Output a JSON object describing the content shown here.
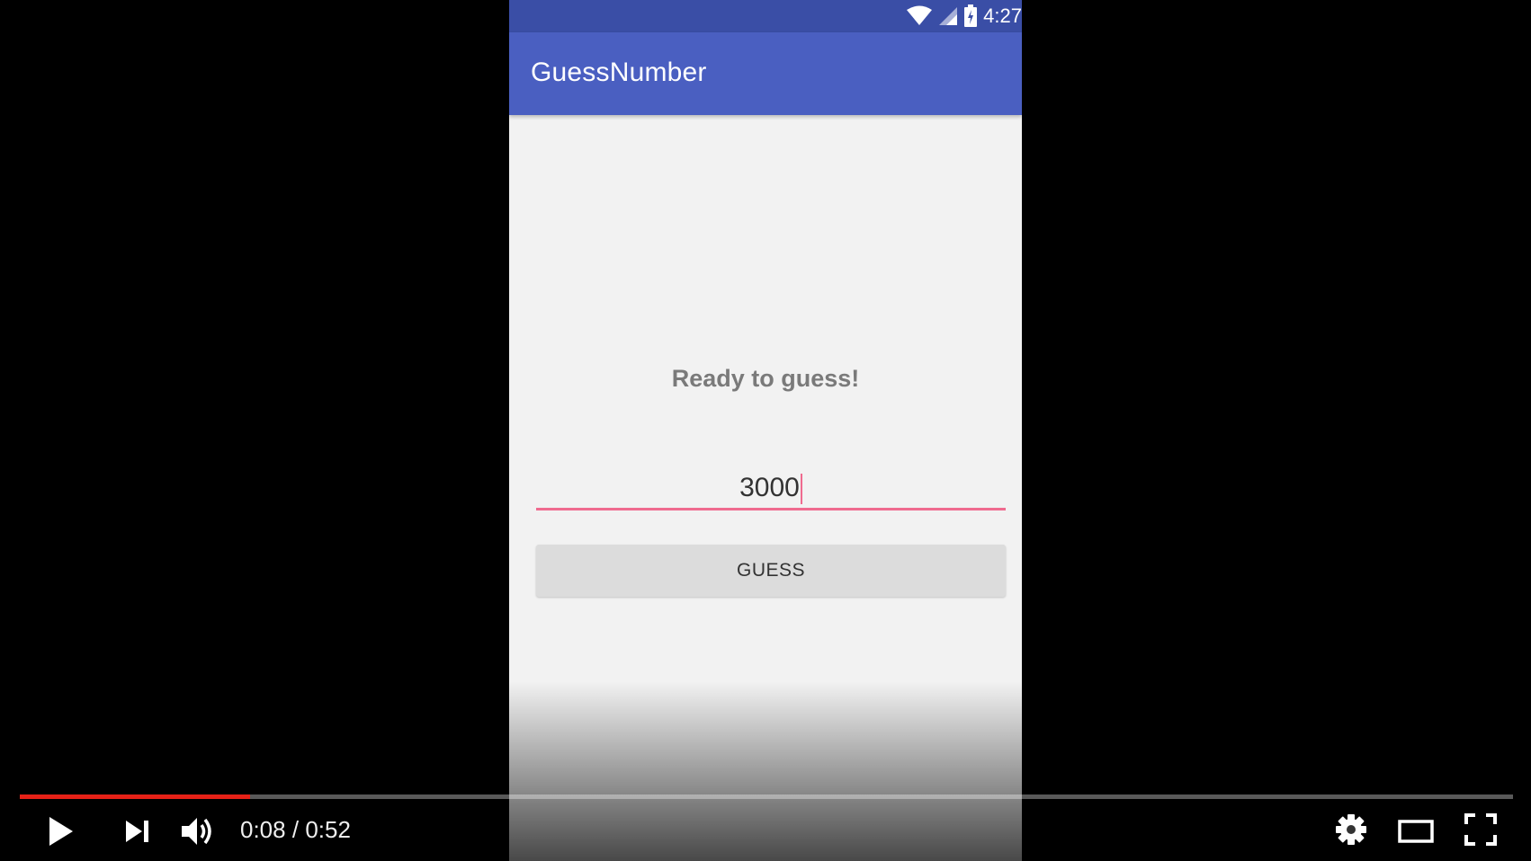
{
  "app": {
    "title": "GuessNumber",
    "status_time": "4:27",
    "status_icons": [
      "wifi-icon",
      "signal-icon",
      "battery-icon"
    ],
    "prompt_text": "Ready to guess!",
    "input_value": "3000",
    "button_label": "GUESS",
    "colors": {
      "status_bar": "#3a4ea6",
      "app_bar": "#4a5fc1",
      "accent": "#ef6b8f",
      "background": "#f2f2f2"
    }
  },
  "player": {
    "current_time": "0:08",
    "separator": "/",
    "duration": "0:52",
    "progress_fraction": 0.154,
    "controls": [
      "play-icon",
      "next-icon",
      "volume-icon",
      "settings-icon",
      "theater-mode-icon",
      "fullscreen-icon"
    ],
    "colors": {
      "played": "#e62117"
    }
  }
}
